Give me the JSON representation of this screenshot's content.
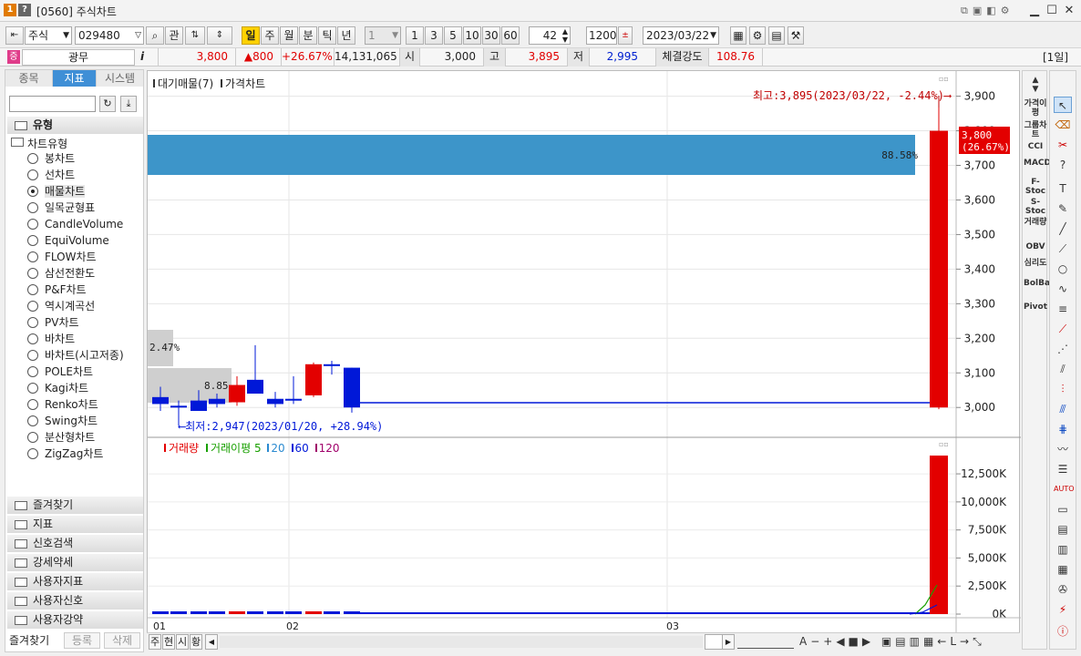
{
  "window": {
    "badge1": "1",
    "badge2": "?",
    "title": "[0560] 주식차트"
  },
  "toolbar": {
    "market": "주식",
    "code": "029480",
    "btn_gwan": "관",
    "periods": [
      "일",
      "주",
      "월",
      "분",
      "틱",
      "년"
    ],
    "interval_value": "1",
    "quick": [
      "1",
      "3",
      "5",
      "10",
      "30",
      "60"
    ],
    "count": "42",
    "slash": "/",
    "total": "1200",
    "date": "2023/03/22"
  },
  "info": {
    "badge": "증",
    "name": "광무",
    "info_icon": "i",
    "price": "3,800",
    "change": "▲800",
    "change_pct": "+26.67%",
    "volume": "14,131,065",
    "open_label": "시",
    "open": "3,000",
    "high_label": "고",
    "high": "3,895",
    "low_label": "저",
    "low": "2,995",
    "strength_label": "체결강도",
    "strength": "108.76",
    "period_tag": "[1일]"
  },
  "left": {
    "tabs": [
      "종목",
      "지표",
      "시스템"
    ],
    "group": "유형",
    "subgroup": "차트유형",
    "chart_types": [
      "봉차트",
      "선차트",
      "매물차트",
      "일목균형표",
      "CandleVolume",
      "EquiVolume",
      "FLOW차트",
      "삼선전환도",
      "P&F차트",
      "역시계곡선",
      "PV차트",
      "바차트",
      "바차트(시고저종)",
      "POLE차트",
      "Kagi차트",
      "Renko차트",
      "Swing차트",
      "분산형차트",
      "ZigZag차트"
    ],
    "selected_index": 2,
    "folders": [
      "즐겨찾기",
      "지표",
      "신호검색",
      "강세약세",
      "사용자지표",
      "사용자신호",
      "사용자강약"
    ],
    "bottom": [
      "즐겨찾기",
      "등록",
      "삭제"
    ]
  },
  "chart": {
    "legend_top": [
      "대기매물(7)",
      "가격차트"
    ],
    "max_note": "최고:3,895(2023/03/22, -2.44%)⟶",
    "min_note": "⟵최저:2,947(2023/01/20, +28.94%)",
    "vp_labels": [
      "88.58%",
      "2.47%",
      "8.85"
    ],
    "price_ticks": [
      "3,900",
      "3,800",
      "3,700",
      "3,600",
      "3,500",
      "3,400",
      "3,300",
      "3,200",
      "3,100",
      "3,000"
    ],
    "current_tag": [
      "3,800",
      "(26.67%)"
    ],
    "legend_bottom": [
      "거래량",
      "거래이평",
      "5",
      "20",
      "60",
      "120"
    ],
    "volume_ticks": [
      "12,500K",
      "10,000K",
      "7,500K",
      "5,000K",
      "2,500K",
      "0K"
    ],
    "x_labels": [
      "01",
      "02",
      "03"
    ],
    "colors": {
      "up": "#e30000",
      "down": "#0018d8",
      "vp": "#3d95c9",
      "ma5": "#18a000",
      "ma20": "#2a8ad0"
    }
  },
  "chart_data": {
    "type": "candlestick",
    "price_range": [
      2940,
      3920
    ],
    "candles": [
      {
        "o": 3030,
        "h": 3060,
        "l": 2990,
        "c": 3010
      },
      {
        "o": 3005,
        "h": 3020,
        "l": 2947,
        "c": 3000
      },
      {
        "o": 3020,
        "h": 3050,
        "l": 2990,
        "c": 2990
      },
      {
        "o": 3025,
        "h": 3040,
        "l": 3000,
        "c": 3010
      },
      {
        "o": 3015,
        "h": 3090,
        "l": 3005,
        "c": 3065
      },
      {
        "o": 3080,
        "h": 3180,
        "l": 3040,
        "c": 3040
      },
      {
        "o": 3025,
        "h": 3045,
        "l": 3000,
        "c": 3010
      },
      {
        "o": 3025,
        "h": 3090,
        "l": 3010,
        "c": 3020
      },
      {
        "o": 3035,
        "h": 3130,
        "l": 3030,
        "c": 3125
      },
      {
        "o": 3125,
        "h": 3135,
        "l": 3095,
        "c": 3120
      },
      {
        "o": 3115,
        "h": 3115,
        "l": 2985,
        "c": 3000
      },
      {
        "o": 3000,
        "h": 3895,
        "l": 2995,
        "c": 3800
      }
    ],
    "volume_range": [
      0,
      14131065
    ],
    "volume_last": 14131065
  },
  "bottom": {
    "btns": [
      "주",
      "현",
      "시",
      "황"
    ],
    "tools": [
      "A",
      "−",
      "+",
      "◀",
      "■",
      "▶"
    ]
  },
  "right_tools": [
    "가격이평",
    "그룹차트",
    "CCI",
    "MACD",
    "F-Stoc",
    "S-Stoc",
    "거래량",
    "OBV",
    "심리도",
    "BolBand",
    "Pivot"
  ]
}
